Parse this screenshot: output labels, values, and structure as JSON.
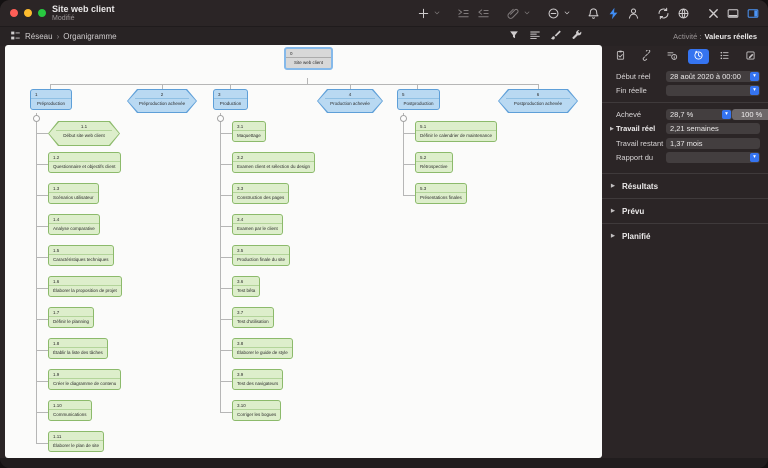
{
  "window": {
    "title": "Site web client",
    "status": "Modifié"
  },
  "toolbar": {
    "icons": [
      "add-icon",
      "chevron-down-icon",
      "indent-icon",
      "outdent-icon",
      "attach-icon",
      "chevron-down-icon",
      "remove-circle-icon",
      "chevron-down-icon",
      "bell-icon",
      "bolt-icon",
      "person-icon",
      "sync-icon",
      "globe-icon",
      "tools-icon",
      "panel-bottom-icon",
      "panel-right-icon"
    ],
    "accent_color": "#3f8cf3"
  },
  "nav": {
    "view_icon": "network-view-icon",
    "view": "Réseau",
    "separator": "›",
    "page": "Organigramme",
    "icons": [
      "filter-icon",
      "style-lines-icon",
      "brush-icon",
      "wrench-icon"
    ]
  },
  "activity": {
    "label": "Activité :",
    "value": "Valeurs réelles"
  },
  "glyphs": {
    "dropdown": "▾",
    "disclosure": "▶"
  },
  "inspector": {
    "tabs": [
      "clipboard-icon",
      "link-icon",
      "list-info-icon",
      "clock-icon",
      "rows-icon",
      "pencil-icon"
    ],
    "active_tab_index": 3,
    "active_tab_color": "#3574f0",
    "fields": {
      "debut_reel": {
        "label": "Début réel",
        "value": "28 août 2020 à 00:00"
      },
      "fin_reelle": {
        "label": "Fin réelle",
        "value": ""
      },
      "acheve": {
        "label": "Achevé",
        "value": "28,7 %",
        "button": "100 %"
      },
      "travail_reel": {
        "label": "Travail réel",
        "value": "2,21 semaines"
      },
      "travail_restant": {
        "label": "Travail restant",
        "value": "1,37 mois"
      },
      "rapport_du": {
        "label": "Rapport du",
        "value": ""
      }
    },
    "sections": {
      "resultats": "Résultats",
      "prevu": "Prévu",
      "planifie": "Planifié"
    }
  },
  "chart": {
    "colors": {
      "group_fill": "#b9d9f2",
      "group_border": "#5e9fd8",
      "task_fill": "#ddeecb",
      "task_border": "#8cba6b",
      "root_fill": "#d8d8d8",
      "selection": "#85b9ea"
    },
    "root": {
      "num": "0",
      "label": "Site web client"
    },
    "row": [
      {
        "num": "1",
        "label": "Préproduction"
      },
      {
        "num": "2",
        "label": "Préproduction achevée"
      },
      {
        "num": "3",
        "label": "Production"
      },
      {
        "num": "4",
        "label": "Production achevée"
      },
      {
        "num": "5",
        "label": "Postproduction"
      },
      {
        "num": "6",
        "label": "Postproduction achevée"
      }
    ],
    "columns": [
      {
        "parent": "1",
        "nodes": [
          {
            "num": "1.1",
            "label": "Début site web client"
          },
          {
            "num": "1.2",
            "label": "Questionnaire et objectifs client"
          },
          {
            "num": "1.3",
            "label": "Scénarios utilisateur"
          },
          {
            "num": "1.4",
            "label": "Analyse comparative"
          },
          {
            "num": "1.5",
            "label": "Caractéristiques techniques"
          },
          {
            "num": "1.6",
            "label": "Élaborer la proposition de projet"
          },
          {
            "num": "1.7",
            "label": "Définir le planning"
          },
          {
            "num": "1.8",
            "label": "Établir la liste des tâches"
          },
          {
            "num": "1.9",
            "label": "Créer le diagramme de contenu"
          },
          {
            "num": "1.10",
            "label": "Communications"
          },
          {
            "num": "1.11",
            "label": "Élaborer le plan de site"
          }
        ]
      },
      {
        "parent": "3",
        "nodes": [
          {
            "num": "3.1",
            "label": "Maquettage"
          },
          {
            "num": "3.2",
            "label": "Examen client et sélection du design"
          },
          {
            "num": "3.3",
            "label": "Construction des pages"
          },
          {
            "num": "3.4",
            "label": "Examen par le client"
          },
          {
            "num": "3.5",
            "label": "Production finale du site"
          },
          {
            "num": "3.6",
            "label": "Test bêta"
          },
          {
            "num": "3.7",
            "label": "Test d'utilisation"
          },
          {
            "num": "3.8",
            "label": "Élaborer le guide de style"
          },
          {
            "num": "3.9",
            "label": "Test des navigateurs"
          },
          {
            "num": "3.10",
            "label": "Corriger les bogues"
          }
        ]
      },
      {
        "parent": "5",
        "nodes": [
          {
            "num": "5.1",
            "label": "Définir le calendrier de maintenance"
          },
          {
            "num": "5.2",
            "label": "Rétrospective"
          },
          {
            "num": "5.3",
            "label": "Présentations finales"
          }
        ]
      }
    ]
  }
}
